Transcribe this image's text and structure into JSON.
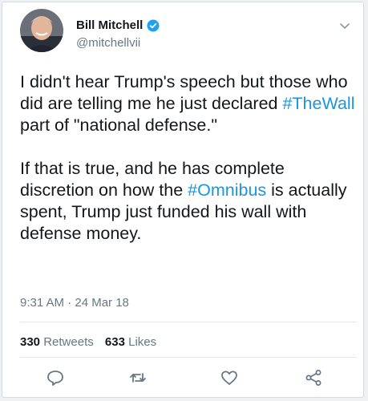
{
  "author": {
    "name": "Bill Mitchell",
    "handle": "@mitchellvii",
    "verified_color": "#1da1f2"
  },
  "tweet": {
    "p1_a": "I didn't hear Trump's speech but those who did are telling me he just declared ",
    "p1_hashtag": "#TheWall",
    "p1_b": " part of \"national defense.\"",
    "p2_a": "If that is true, and he has complete discretion on how the ",
    "p2_hashtag": "#Omnibus",
    "p2_b": " is actually spent, Trump just funded his wall with defense money.",
    "timestamp": "9:31 AM · 24 Mar 18",
    "hashtag_color": "#1b95e0"
  },
  "stats": {
    "retweets_count": "330",
    "retweets_label": "Retweets",
    "likes_count": "633",
    "likes_label": "Likes"
  },
  "actions": [
    "reply-icon",
    "retweet-icon",
    "like-icon",
    "share-icon"
  ]
}
